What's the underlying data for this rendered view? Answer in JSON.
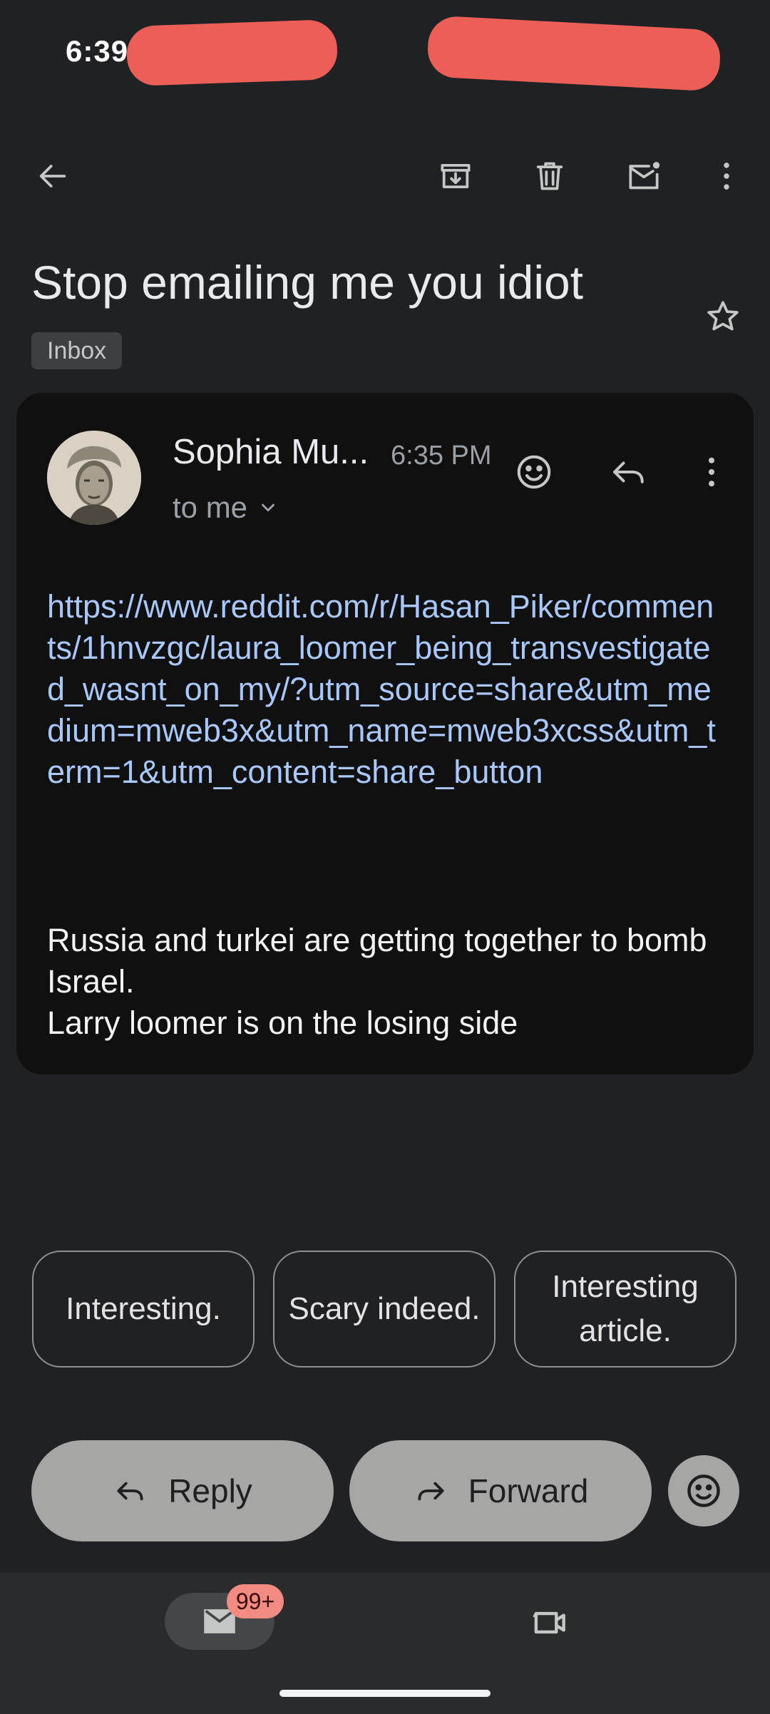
{
  "status_bar": {
    "time": "6:39"
  },
  "toolbar": {
    "icons": [
      "back-arrow-icon",
      "archive-icon",
      "trash-icon",
      "mark-unread-icon",
      "more-vert-icon"
    ]
  },
  "email": {
    "subject": "Stop emailing me you idiot",
    "label": "Inbox",
    "sender_name": "Sophia Mu...",
    "time": "6:35 PM",
    "recipient": "to me",
    "link": "https://www.reddit.com/r/Hasan_Piker/comments/1hnvzgc/laura_loomer_being_transvestigated_wasnt_on_my/?utm_source=share&utm_medium=mweb3x&utm_name=mweb3xcss&utm_term=1&utm_content=share_button",
    "body_line_1": "Russia and turkei are getting together to bomb Israel.",
    "body_line_2": "Larry loomer is on the losing side"
  },
  "smart_replies": [
    "Interesting.",
    "Scary indeed.",
    "Interesting article."
  ],
  "actions": {
    "reply_label": "Reply",
    "forward_label": "Forward"
  },
  "bottom_nav": {
    "mail_badge": "99+"
  },
  "colors": {
    "background": "#202124",
    "card": "#101010",
    "link": "#a8c7fa",
    "badge": "#f28b82",
    "redaction": "#ec5f57"
  }
}
